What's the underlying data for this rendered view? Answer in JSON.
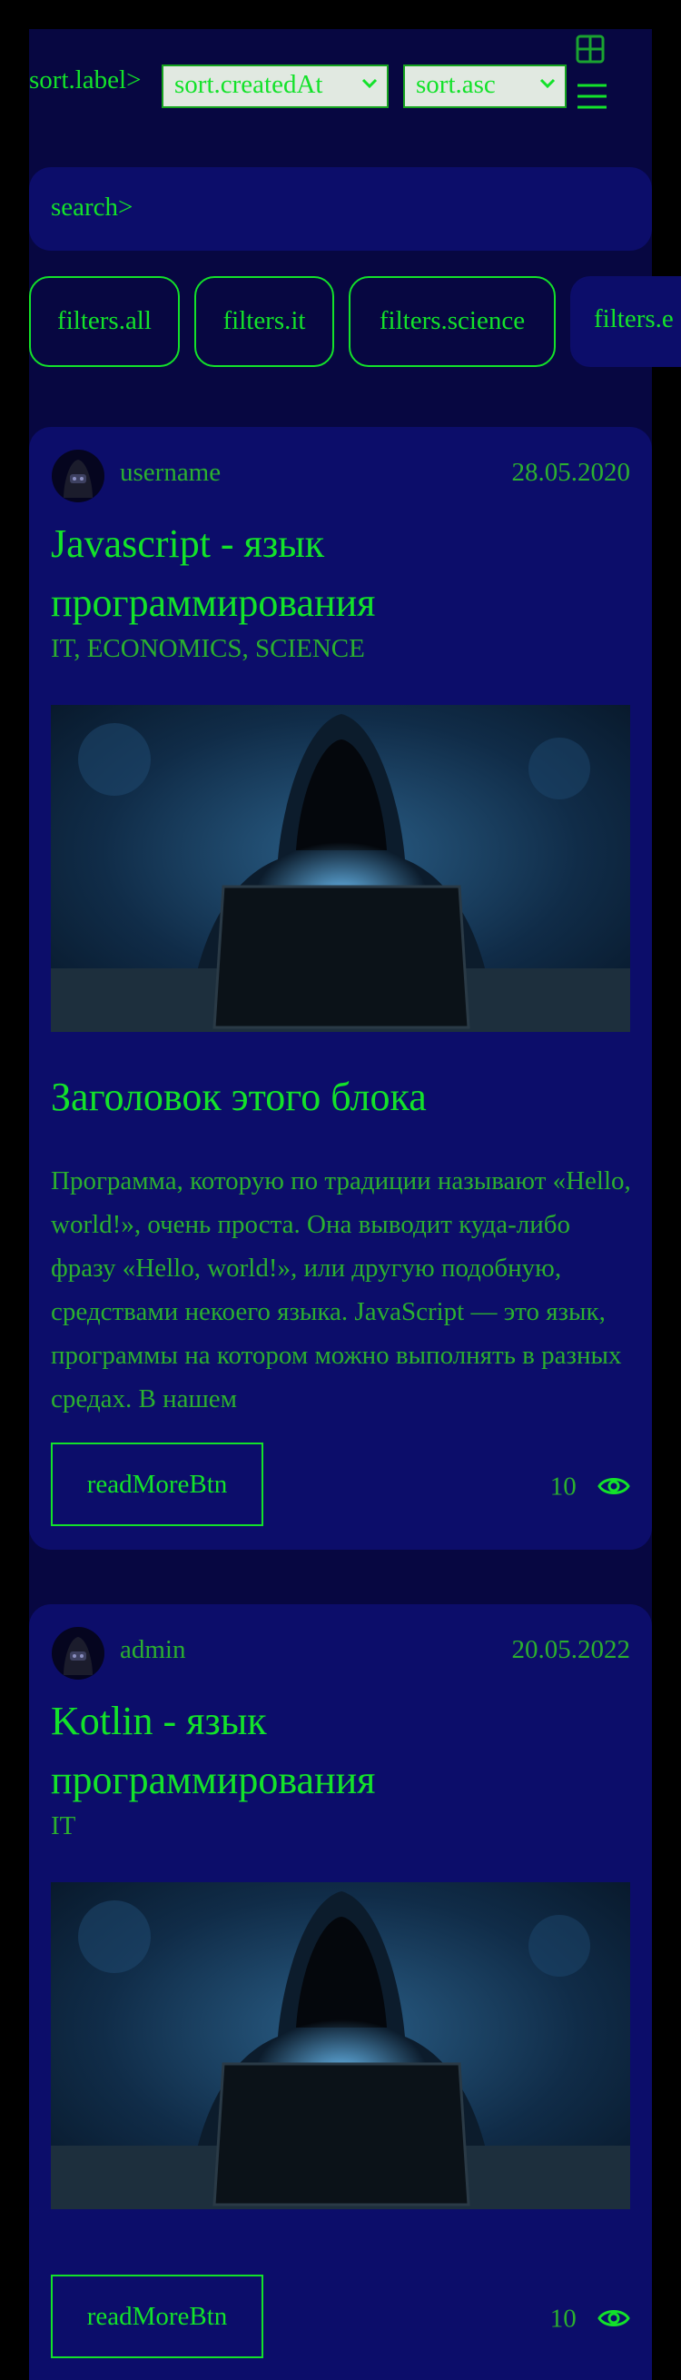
{
  "sort": {
    "label": "sort.label>",
    "field_value": "sort.createdAt",
    "order_value": "sort.asc"
  },
  "search": {
    "text": "search>"
  },
  "filters": [
    {
      "label": "filters.all"
    },
    {
      "label": "filters.it"
    },
    {
      "label": "filters.science"
    },
    {
      "label": "filters.e"
    }
  ],
  "articles": [
    {
      "author": "username",
      "date": "28.05.2020",
      "title": "Javascript - язык программирования",
      "tags": "IT, ECONOMICS, SCIENCE",
      "block_title": "Заголовок этого блока",
      "block_text": "Программа, которую по традиции называют «Hello, world!», очень проста. Она выводит куда-либо фразу «Hello, world!», или другую подобную, средствами некоего языка. JavaScript — это язык, программы на котором можно выполнять в разных средах. В нашем",
      "read_more": "readMoreBtn",
      "views": "10"
    },
    {
      "author": "admin",
      "date": "20.05.2022",
      "title": "Kotlin - язык программирования",
      "tags": "IT",
      "read_more": "readMoreBtn",
      "views": "10"
    }
  ],
  "colors": {
    "background": "#070741",
    "card": "#0c0d6a",
    "accent": "#13e22a"
  }
}
